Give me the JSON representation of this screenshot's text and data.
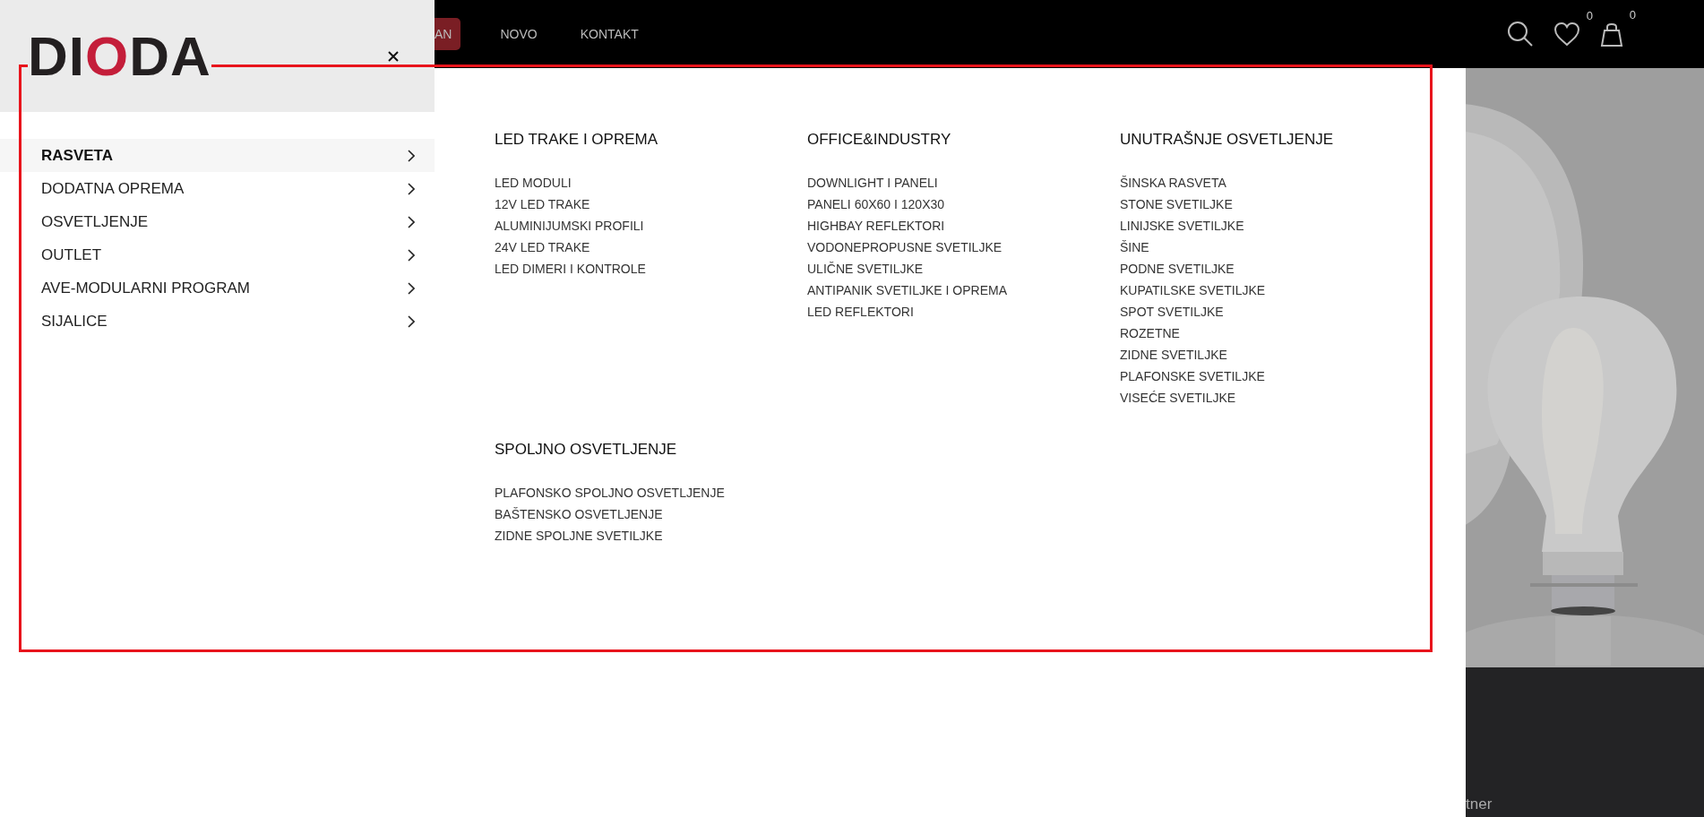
{
  "logo": {
    "parts": [
      {
        "text": "DI",
        "color": "#231f20"
      },
      {
        "text": "O",
        "color": "#c41e3a"
      },
      {
        "text": "DA",
        "color": "#231f20"
      }
    ]
  },
  "top_nav": [
    {
      "label": "AN",
      "selected": true
    },
    {
      "label": "NOVO",
      "selected": false
    },
    {
      "label": "KONTAKT",
      "selected": false
    }
  ],
  "header_icons": [
    {
      "kind": "search"
    },
    {
      "kind": "wishlist",
      "badge": "0"
    },
    {
      "kind": "cart",
      "badge": "0"
    }
  ],
  "sidebar": {
    "items": [
      {
        "label": "RASVETA",
        "selected": true
      },
      {
        "label": "DODATNA OPREMA",
        "selected": false
      },
      {
        "label": "OSVETLJENJE",
        "selected": false
      },
      {
        "label": "OUTLET",
        "selected": false
      },
      {
        "label": "AVE-MODULARNI PROGRAM",
        "selected": false
      },
      {
        "label": "SIJALICE",
        "selected": false
      }
    ]
  },
  "mega_menu": {
    "groups": [
      {
        "title": "LED TRAKE I OPREMA",
        "items": [
          "LED MODULI",
          "12V LED TRAKE",
          "ALUMINIJUMSKI PROFILI",
          "24V LED TRAKE",
          "LED DIMERI I KONTROLE"
        ]
      },
      {
        "title": "OFFICE&INDUSTRY",
        "items": [
          "DOWNLIGHT I PANELI",
          "PANELI 60X60 I 120X30",
          "HIGHBAY REFLEKTORI",
          "VODONEPROPUSNE SVETILJKE",
          "ULIČNE SVETILJKE",
          "ANTIPANIK SVETILJKE I OPREMA",
          "LED REFLEKTORI"
        ]
      },
      {
        "title": "UNUTRAŠNJE OSVETLJENJE",
        "items": [
          "ŠINSKA RASVETA",
          "STONE SVETILJKE",
          "LINIJSKE SVETILJKE",
          "ŠINE",
          "PODNE SVETILJKE",
          "KUPATILSKE SVETILJKE",
          "SPOT SVETILJKE",
          "ROZETNE",
          "ZIDNE SVETILJKE",
          "PLAFONSKE SVETILJKE",
          "VISEĆE SVETILJKE"
        ]
      },
      {
        "title": "SPOLJNO OSVETLJENJE",
        "items": [
          "PLAFONSKO SPOLJNO OSVETLJENJE",
          "BAŠTENSKO OSVETLJENJE",
          "ZIDNE SPOLJNE SVETILJKE"
        ]
      }
    ]
  },
  "footer_text": "tner",
  "annotation": {
    "kind": "rectangle"
  }
}
